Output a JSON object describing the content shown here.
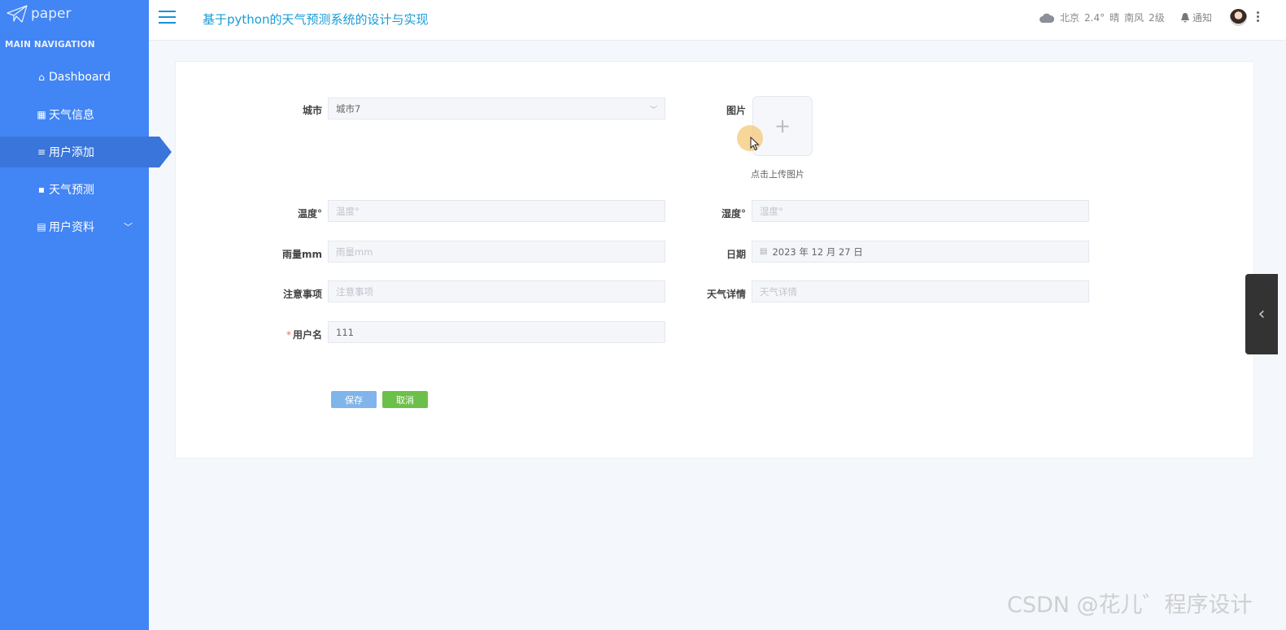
{
  "sidebar": {
    "logo_text": "paper",
    "nav_title": "MAIN NAVIGATION",
    "items": [
      {
        "label": "Dashboard",
        "icon": "home-icon"
      },
      {
        "label": "天气信息",
        "icon": "grid-icon"
      },
      {
        "label": "用户添加",
        "icon": "list-icon"
      },
      {
        "label": "天气预测",
        "icon": "chip-icon"
      },
      {
        "label": "用户资料",
        "icon": "calendar-icon"
      }
    ]
  },
  "header": {
    "title": "基于python的天气预测系统的设计与实现",
    "weather": {
      "city": "北京",
      "temp": "2.4°",
      "condition": "晴",
      "wind": "南风",
      "level": "2级"
    },
    "notice": "通知"
  },
  "form": {
    "city": {
      "label": "城市",
      "value": "城市7"
    },
    "image": {
      "label": "图片",
      "hint": "点击上传图片"
    },
    "temperature": {
      "label": "温度°",
      "placeholder": "温度°"
    },
    "humidity": {
      "label": "湿度°",
      "placeholder": "湿度°"
    },
    "rainfall": {
      "label": "雨量mm",
      "placeholder": "雨量mm"
    },
    "date": {
      "label": "日期",
      "value": "2023 年 12 月 27 日"
    },
    "notes": {
      "label": "注意事项",
      "placeholder": "注意事项"
    },
    "details": {
      "label": "天气详情",
      "placeholder": "天气详情"
    },
    "username": {
      "label": "用户名",
      "required": "*",
      "value": "111"
    },
    "save": "保存",
    "cancel": "取消"
  },
  "watermark": "CSDN @花儿゛程序设计"
}
